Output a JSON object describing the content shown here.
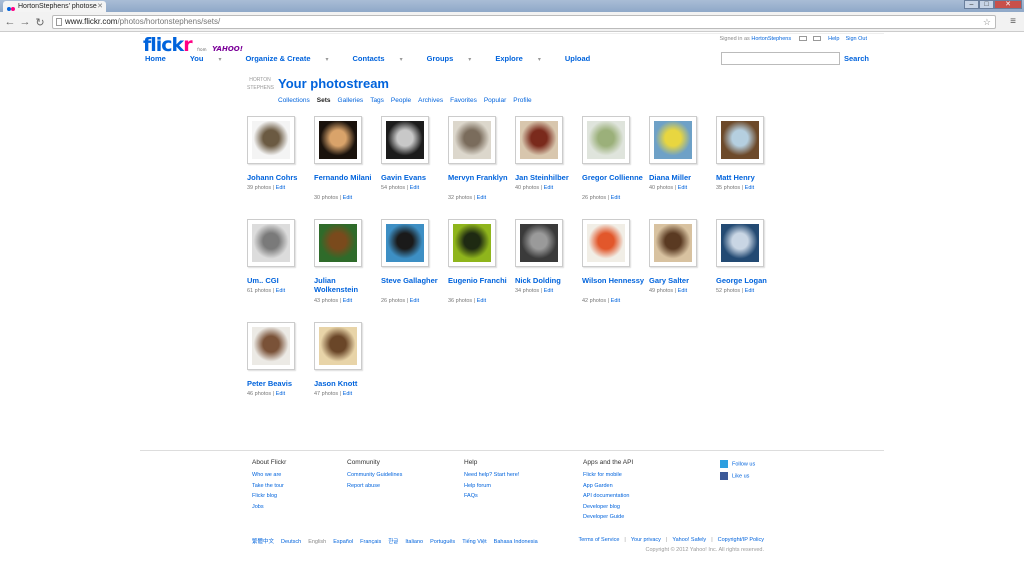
{
  "browser": {
    "tab_title": "HortonStephens' photose",
    "url_host": "www.flickr.com",
    "url_path": "/photos/hortonstephens/sets/"
  },
  "header": {
    "logo_text": "flickr",
    "logo_from": "from",
    "logo_yahoo": "YAHOO!",
    "nav": [
      {
        "label": "Home",
        "dropdown": false
      },
      {
        "label": "You",
        "dropdown": true
      },
      {
        "label": "Organize & Create",
        "dropdown": true
      },
      {
        "label": "Contacts",
        "dropdown": true
      },
      {
        "label": "Groups",
        "dropdown": true
      },
      {
        "label": "Explore",
        "dropdown": true
      },
      {
        "label": "Upload",
        "dropdown": false
      }
    ],
    "signed_in_as": "Signed in as",
    "username": "HortonStephens",
    "help": "Help",
    "sign_out": "Sign Out",
    "search_label": "Search",
    "search_value": ""
  },
  "photostream": {
    "buddy_text": "HORTON STEPHENS",
    "title": "Your photostream",
    "subnav": [
      {
        "label": "Collections",
        "active": false
      },
      {
        "label": "Sets",
        "active": true
      },
      {
        "label": "Galleries",
        "active": false
      },
      {
        "label": "Tags",
        "active": false
      },
      {
        "label": "People",
        "active": false
      },
      {
        "label": "Archives",
        "active": false
      },
      {
        "label": "Favorites",
        "active": false
      },
      {
        "label": "Popular",
        "active": false
      },
      {
        "label": "Profile",
        "active": false
      }
    ]
  },
  "sets": [
    {
      "title": "Johann Cohrs",
      "count": "39 photos",
      "edit": "Edit",
      "colors": [
        "#f4f4f4",
        "#6b5a42"
      ]
    },
    {
      "title": "Fernando Milani",
      "count": "30 photos",
      "edit": "Edit",
      "colors": [
        "#1a120c",
        "#d9a36a"
      ]
    },
    {
      "title": "Gavin Evans",
      "count": "54 photos",
      "edit": "Edit",
      "colors": [
        "#1c1c1c",
        "#c8c8c8"
      ]
    },
    {
      "title": "Mervyn Franklyn",
      "count": "32 photos",
      "edit": "Edit",
      "colors": [
        "#dcd7cc",
        "#7a6c5c"
      ]
    },
    {
      "title": "Jan Steinhilber",
      "count": "40 photos",
      "edit": "Edit",
      "colors": [
        "#d8c6ad",
        "#7a2a1c"
      ]
    },
    {
      "title": "Gregor Collienne",
      "count": "26 photos",
      "edit": "Edit",
      "colors": [
        "#dfe4dc",
        "#9bb07a"
      ]
    },
    {
      "title": "Diana Miller",
      "count": "40 photos",
      "edit": "Edit",
      "colors": [
        "#6ea1c7",
        "#e8d640"
      ]
    },
    {
      "title": "Matt Henry",
      "count": "35 photos",
      "edit": "Edit",
      "colors": [
        "#6d4a2a",
        "#b5cfe0"
      ]
    },
    {
      "title": "Um.. CGI",
      "count": "61 photos",
      "edit": "Edit",
      "colors": [
        "#dcdcdc",
        "#7a7a7a"
      ]
    },
    {
      "title": "Julian Wolkenstein",
      "count": "43 photos",
      "edit": "Edit",
      "colors": [
        "#2f6b2a",
        "#7a4a1c"
      ]
    },
    {
      "title": "Steve Gallagher",
      "count": "26 photos",
      "edit": "Edit",
      "colors": [
        "#3d8fc4",
        "#1a1a1a"
      ]
    },
    {
      "title": "Eugenio Franchi",
      "count": "36 photos",
      "edit": "Edit",
      "colors": [
        "#8fb51c",
        "#1e2a12"
      ]
    },
    {
      "title": "Nick Dolding",
      "count": "34 photos",
      "edit": "Edit",
      "colors": [
        "#3a3a3a",
        "#9a9a9a"
      ]
    },
    {
      "title": "Wilson Hennessy",
      "count": "42 photos",
      "edit": "Edit",
      "colors": [
        "#f1eee6",
        "#e2572b"
      ]
    },
    {
      "title": "Gary Salter",
      "count": "49 photos",
      "edit": "Edit",
      "colors": [
        "#d8c2a0",
        "#5a3a22"
      ]
    },
    {
      "title": "George Logan",
      "count": "52 photos",
      "edit": "Edit",
      "colors": [
        "#234a73",
        "#c9d6e4"
      ]
    },
    {
      "title": "Peter Beavis",
      "count": "46 photos",
      "edit": "Edit",
      "colors": [
        "#eceae5",
        "#7a5238"
      ]
    },
    {
      "title": "Jason Knott",
      "count": "47 photos",
      "edit": "Edit",
      "colors": [
        "#e8d4a8",
        "#6a4628"
      ]
    }
  ],
  "footer": {
    "columns": [
      {
        "heading": "About Flickr",
        "links": [
          "Who we are",
          "Take the tour",
          "Flickr blog",
          "Jobs"
        ]
      },
      {
        "heading": "Community",
        "links": [
          "Community Guidelines",
          "Report abuse"
        ]
      },
      {
        "heading": "Help",
        "links": [
          "Need help? Start here!",
          "Help forum",
          "FAQs"
        ]
      },
      {
        "heading": "Apps and the API",
        "links": [
          "Flickr for mobile",
          "App Garden",
          "API documentation",
          "Developer blog",
          "Developer Guide"
        ]
      }
    ],
    "social": [
      {
        "label": "Follow us",
        "icon": "twitter-icon",
        "color": "#2d9fe0"
      },
      {
        "label": "Like us",
        "icon": "facebook-icon",
        "color": "#3b5998"
      }
    ],
    "languages": [
      {
        "label": "繁體中文",
        "current": false
      },
      {
        "label": "Deutsch",
        "current": false
      },
      {
        "label": "English",
        "current": true
      },
      {
        "label": "Español",
        "current": false
      },
      {
        "label": "Français",
        "current": false
      },
      {
        "label": "한글",
        "current": false
      },
      {
        "label": "Italiano",
        "current": false
      },
      {
        "label": "Português",
        "current": false
      },
      {
        "label": "Tiếng Việt",
        "current": false
      },
      {
        "label": "Bahasa Indonesia",
        "current": false
      }
    ],
    "legal": [
      "Terms of Service",
      "Your privacy",
      "Yahoo! Safely",
      "Copyright/IP Policy"
    ],
    "copyright": "Copyright © 2012 Yahoo! Inc. All rights reserved."
  }
}
